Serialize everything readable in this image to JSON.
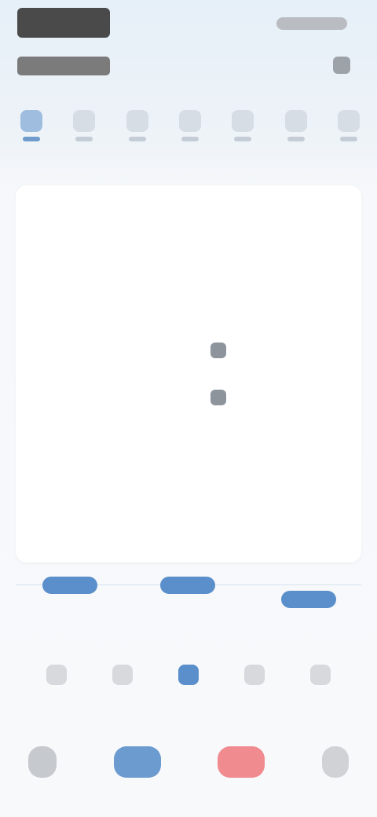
{
  "header": {
    "title": "",
    "subtitle": "",
    "right_text": ""
  },
  "week": {
    "days": [
      {
        "label": "",
        "active": true
      },
      {
        "label": "",
        "active": false
      },
      {
        "label": "",
        "active": false
      },
      {
        "label": "",
        "active": false
      },
      {
        "label": "",
        "active": false
      },
      {
        "label": "",
        "active": false
      },
      {
        "label": "",
        "active": false
      }
    ]
  },
  "summary": {
    "link_text": "",
    "metric_left": {
      "value": "",
      "label": ""
    },
    "metric_right": {
      "value": "",
      "label": ""
    },
    "info_link_1": "",
    "info_link_2": "",
    "info_value": "",
    "legend": [
      {
        "label": ""
      },
      {
        "label": ""
      }
    ]
  },
  "timeline": {
    "pills": [
      "",
      "",
      ""
    ]
  },
  "categories": [
    {
      "label": "",
      "active": false
    },
    {
      "label": "",
      "active": false
    },
    {
      "label": "",
      "active": true
    },
    {
      "label": "",
      "active": false
    },
    {
      "label": "",
      "active": false
    }
  ],
  "bottom_nav": [
    {
      "label": "",
      "icon": "home-icon"
    },
    {
      "label": "",
      "icon": "plus-icon"
    },
    {
      "label": "",
      "icon": "record-icon"
    },
    {
      "label": "",
      "icon": "profile-icon"
    }
  ],
  "colors": {
    "accent_blue": "#5b8fcb",
    "accent_red": "#f08b8f",
    "background": "#f6f8fb"
  }
}
